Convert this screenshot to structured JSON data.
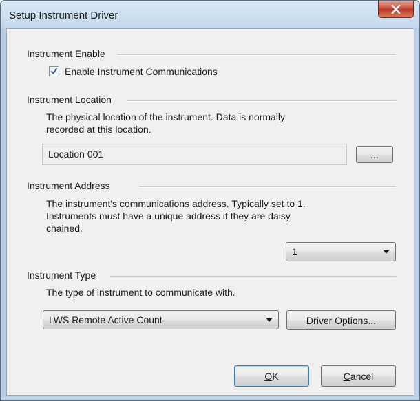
{
  "window": {
    "title": "Setup Instrument Driver",
    "close_icon": "close-icon"
  },
  "instrument_enable": {
    "group_label": "Instrument Enable",
    "checkbox_label": "Enable Instrument Communications",
    "checked": true
  },
  "instrument_location": {
    "group_label": "Instrument Location",
    "description_line1": "The physical location of the instrument. Data is normally",
    "description_line2": "recorded at this location.",
    "value": "Location 001",
    "browse_label": "..."
  },
  "instrument_address": {
    "group_label": "Instrument Address",
    "description_line1": "The instrument's communications address. Typically set to 1.",
    "description_line2": "Instruments must have a unique address if they are daisy",
    "description_line3": "chained.",
    "selected": "1"
  },
  "instrument_type": {
    "group_label": "Instrument Type",
    "description": "The type of instrument to communicate with.",
    "selected": "LWS Remote Active Count",
    "driver_options": {
      "first_char": "D",
      "rest": "river Options..."
    }
  },
  "buttons": {
    "ok": {
      "first_char": "O",
      "rest": "K"
    },
    "cancel": {
      "first_char": "C",
      "rest": "ancel"
    }
  }
}
